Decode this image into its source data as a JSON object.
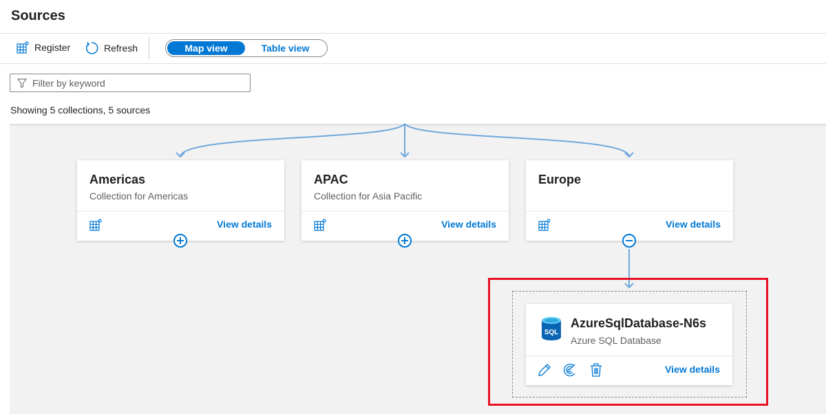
{
  "page": {
    "title": "Sources"
  },
  "toolbar": {
    "register": "Register",
    "refresh": "Refresh",
    "map_view": "Map view",
    "table_view": "Table view",
    "active_view": "Map view"
  },
  "filter": {
    "placeholder": "Filter by keyword",
    "value": ""
  },
  "summary": "Showing 5 collections, 5 sources",
  "collections": [
    {
      "name": "Americas",
      "description": "Collection for Americas",
      "view_details": "View details",
      "expanded": false
    },
    {
      "name": "APAC",
      "description": "Collection for Asia Pacific",
      "view_details": "View details",
      "expanded": false
    },
    {
      "name": "Europe",
      "description": "",
      "view_details": "View details",
      "expanded": true
    }
  ],
  "source": {
    "name": "AzureSqlDatabase-N6s",
    "type": "Azure SQL Database",
    "icon_text": "SQL",
    "view_details": "View details"
  },
  "colors": {
    "accent": "#0078d4",
    "highlight": "#e81123",
    "connector": "#6fa8dc"
  }
}
